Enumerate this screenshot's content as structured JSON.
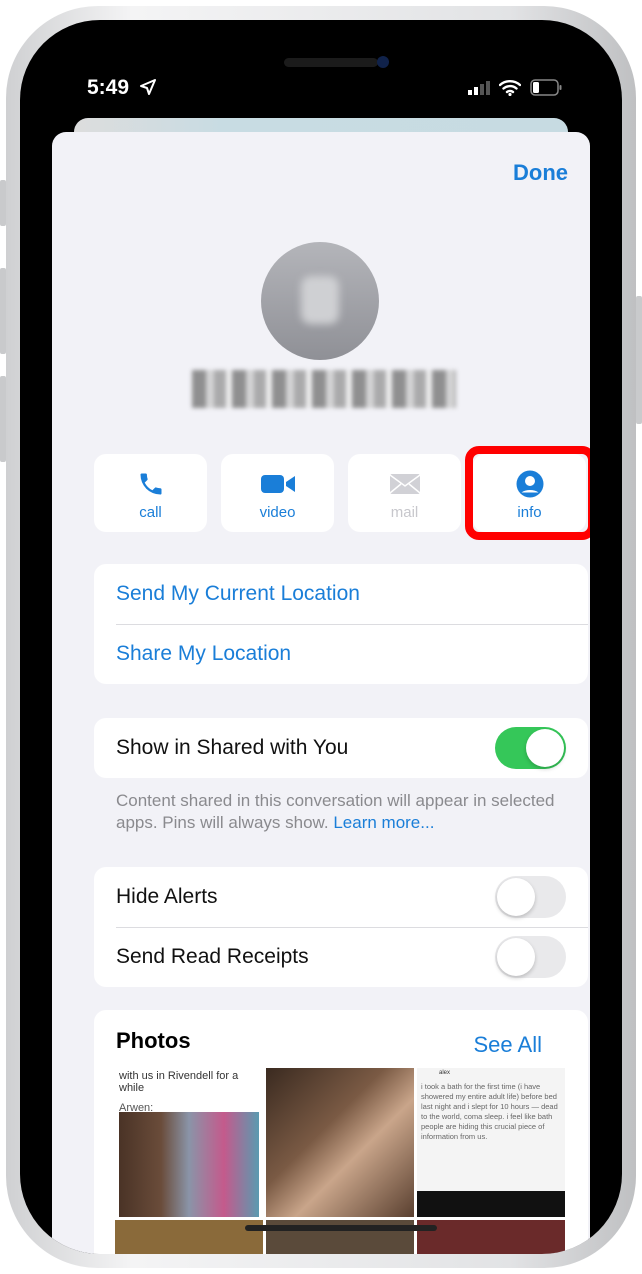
{
  "status": {
    "time": "5:49",
    "location_icon": "location-arrow-icon",
    "signal_icon": "cellular-signal-icon",
    "wifi_icon": "wifi-icon",
    "battery_icon": "battery-icon"
  },
  "header": {
    "done_label": "Done"
  },
  "contact": {
    "avatar_icon": "person-avatar-icon"
  },
  "actions": [
    {
      "label": "call",
      "icon": "phone-icon",
      "enabled": true
    },
    {
      "label": "video",
      "icon": "video-icon",
      "enabled": true
    },
    {
      "label": "mail",
      "icon": "envelope-icon",
      "enabled": false
    },
    {
      "label": "info",
      "icon": "person-circle-icon",
      "enabled": true,
      "highlighted": true
    }
  ],
  "location": {
    "send_current": "Send My Current Location",
    "share": "Share My Location"
  },
  "shared": {
    "label": "Show in Shared with You",
    "on": true,
    "footer": "Content shared in this conversation will appear in selected apps. Pins will always show.",
    "learn_more": "Learn more..."
  },
  "alerts": {
    "hide_alerts": "Hide Alerts",
    "hide_alerts_on": false,
    "read_receipts": "Send Read Receipts",
    "read_receipts_on": false
  },
  "photos": {
    "title": "Photos",
    "see_all": "See All",
    "tile1_caption": "with us in Rivendell for a while",
    "tile1_sub": "Arwen:",
    "tile3_user": "alex",
    "tile3_text": "i took a bath for the first time (i have showered my entire adult life) before bed last night and i slept for 10 hours — dead to the world, coma sleep. i feel like bath people are hiding this crucial piece of information from us."
  },
  "colors": {
    "accent": "#1a7ed8",
    "toggle_on": "#35c759",
    "highlight": "#ff0000",
    "background": "#f2f2f7"
  }
}
